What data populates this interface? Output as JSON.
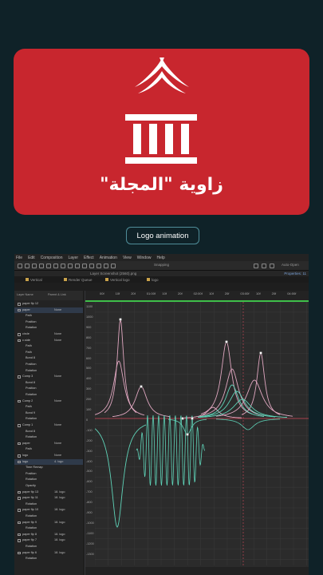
{
  "brand_card": {
    "title": "زاوية \"المجلة\"",
    "bg_color": "#c8262e"
  },
  "button": {
    "label": "Logo animation"
  },
  "app": {
    "menu": [
      "File",
      "Edit",
      "Composition",
      "Layer",
      "Effect",
      "Animation",
      "View",
      "Window",
      "Help"
    ],
    "toolbar": {
      "snapping": "Snapping",
      "auto_open": "Auto-Open"
    },
    "layer_path": "Layer  Screenshot (2560).png",
    "properties_label": "Properties: 11",
    "tabs": [
      "Vertical",
      "Render Queue",
      "Vertical logo",
      "logo"
    ],
    "layer_header": {
      "name": "Layer Name",
      "parent": "Parent & Link"
    },
    "layers": [
      {
        "name": "paper fip 12",
        "parent": ""
      },
      {
        "name": "paper",
        "parent": "None"
      },
      {
        "name": "Path",
        "parent": ""
      },
      {
        "name": "Position",
        "parent": ""
      },
      {
        "name": "Rotation",
        "parent": ""
      },
      {
        "name": "circle",
        "parent": "None"
      },
      {
        "name": "c.side",
        "parent": "None"
      },
      {
        "name": "Path",
        "parent": ""
      },
      {
        "name": "Path",
        "parent": ""
      },
      {
        "name": "Bond 8",
        "parent": ""
      },
      {
        "name": "Position",
        "parent": ""
      },
      {
        "name": "Rotation",
        "parent": ""
      },
      {
        "name": "Comp 3",
        "parent": "None"
      },
      {
        "name": "Bond 8",
        "parent": ""
      },
      {
        "name": "Position",
        "parent": ""
      },
      {
        "name": "Rotation",
        "parent": ""
      },
      {
        "name": "Comp 2",
        "parent": "None"
      },
      {
        "name": "Path",
        "parent": ""
      },
      {
        "name": "Bond 9",
        "parent": ""
      },
      {
        "name": "Rotation",
        "parent": ""
      },
      {
        "name": "Comp 1",
        "parent": "None"
      },
      {
        "name": "Bond 8",
        "parent": ""
      },
      {
        "name": "Rotation",
        "parent": ""
      },
      {
        "name": "paper",
        "parent": "None"
      },
      {
        "name": "Path",
        "parent": ""
      },
      {
        "name": "logo",
        "parent": "None"
      },
      {
        "name": "logo",
        "parent": "4. logo"
      },
      {
        "name": "Time Remap",
        "parent": ""
      },
      {
        "name": "Position",
        "parent": ""
      },
      {
        "name": "Rotation",
        "parent": ""
      },
      {
        "name": "Opacity",
        "parent": ""
      },
      {
        "name": "paper fip 13",
        "parent": "18. logo"
      },
      {
        "name": "paper fip 11",
        "parent": "18. logo"
      },
      {
        "name": "Rotation",
        "parent": ""
      },
      {
        "name": "paper fip 10",
        "parent": "18. logo"
      },
      {
        "name": "Rotation",
        "parent": ""
      },
      {
        "name": "paper fip 9",
        "parent": "18. logo"
      },
      {
        "name": "Rotation",
        "parent": ""
      },
      {
        "name": "paper fip 8",
        "parent": "18. logo"
      },
      {
        "name": "paper fip 7",
        "parent": "18. logo"
      },
      {
        "name": "Rotation",
        "parent": ""
      },
      {
        "name": "paper fip 6",
        "parent": "18. logo"
      },
      {
        "name": "Rotation",
        "parent": ""
      }
    ],
    "ruler_ticks": [
      "00f",
      "10f",
      "20f",
      "01:00f",
      "10f",
      "20f",
      "02:00f",
      "10f",
      "20f",
      "03:00f",
      "10f",
      "20f",
      "04:00f"
    ],
    "value_ticks": [
      "1100",
      "1000",
      "900",
      "800",
      "700",
      "600",
      "500",
      "400",
      "300",
      "200",
      "100",
      "0",
      "-100",
      "-200",
      "-300",
      "-400",
      "-500",
      "-600",
      "-700",
      "-800",
      "-900",
      "-1000",
      "-1100",
      "-1200",
      "-1300"
    ],
    "colors": {
      "pink_curve": "#e0a7c0",
      "cyan_curve": "#5fd3b8",
      "current_time": "#d24a5a",
      "work_area": "#3fbf4a"
    }
  }
}
